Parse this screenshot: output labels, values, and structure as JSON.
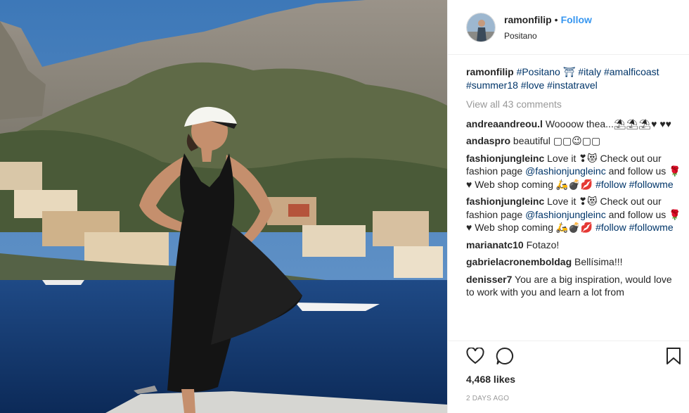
{
  "post": {
    "username": "ramonfilip",
    "separator": "•",
    "follow_label": "Follow",
    "location": "Positano"
  },
  "caption": {
    "username": "ramonfilip",
    "tags_line1": "#Positano ⛩ #italy #amalficoast",
    "tags_line2": "#summer18 #love #instatravel"
  },
  "view_all_label": "View all 43 comments",
  "comments": [
    {
      "user": "andreaandreou.l",
      "text": "Woooow thea...⛱⛱⛱♥ ♥♥"
    },
    {
      "user": "andaspro",
      "text": "beautiful ▢▢😉▢▢"
    },
    {
      "user": "fashionjungleinc",
      "text": "Love it ❣😻 Check out our fashion page",
      "mention": "@fashionjungleinc",
      "text2": "and follow us 🌹♥ Web shop coming 🛵💣💋",
      "tag1": "#follow",
      "tag2": "#followme"
    },
    {
      "user": "fashionjungleinc",
      "text": "Love it ❣😻 Check out our fashion page",
      "mention": "@fashionjungleinc",
      "text2": "and follow us 🌹♥ Web shop coming 🛵💣💋",
      "tag1": "#follow",
      "tag2": "#followme"
    },
    {
      "user": "marianatc10",
      "text": "Fotazo!"
    },
    {
      "user": "gabrielacronemboldag",
      "text": "Bellísima!!!"
    },
    {
      "user": "denisser7",
      "text": "You are a big inspiration, would love to work with you and learn a lot from"
    }
  ],
  "likes_label": "4,468 likes",
  "date_label": "2 DAYS AGO",
  "icons": {
    "like": "heart-icon",
    "comment": "comment-icon",
    "save": "bookmark-icon"
  },
  "colors": {
    "link": "#3897f0",
    "hashtag": "#003569",
    "muted": "#999999"
  }
}
